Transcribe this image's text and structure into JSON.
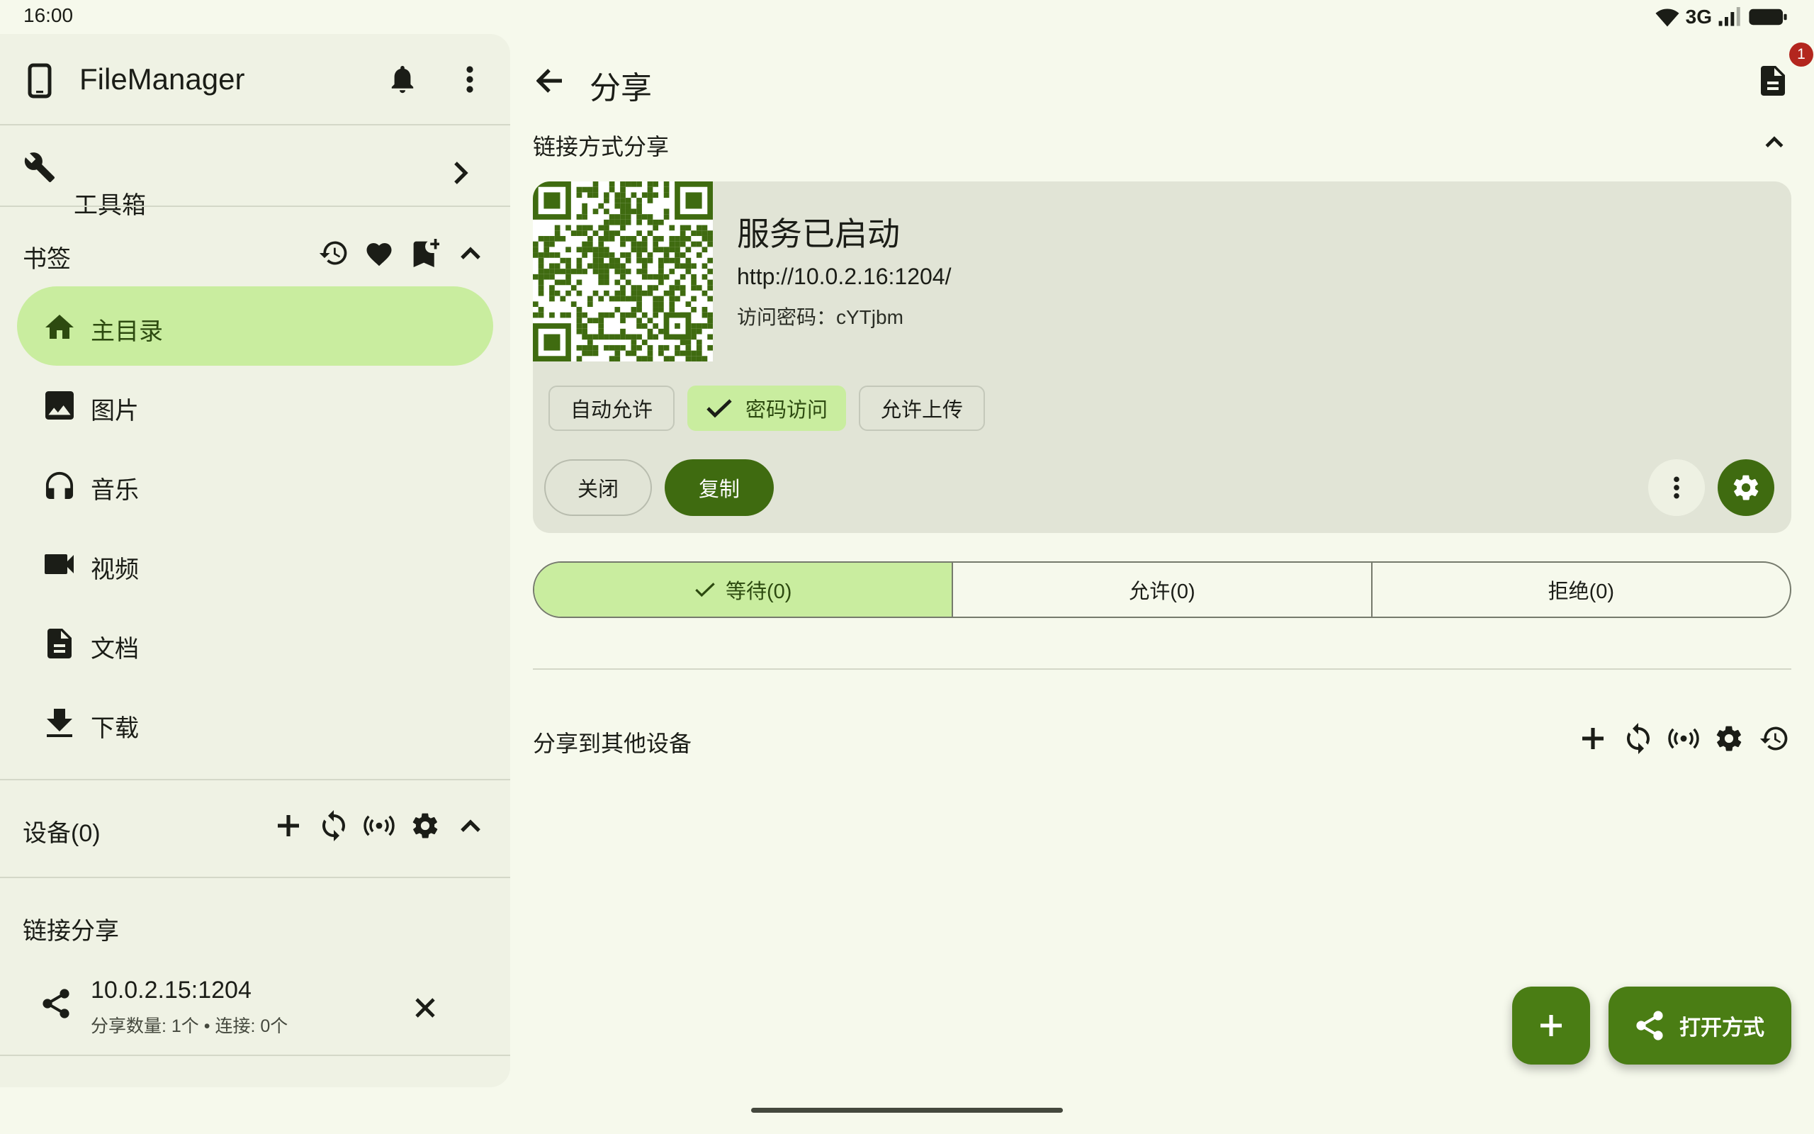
{
  "status_bar": {
    "time": "16:00",
    "network": "3G"
  },
  "drawer": {
    "app_title": "FileManager",
    "toolbox_label": "工具箱",
    "bookmarks": {
      "title": "书签",
      "items": [
        {
          "label": "主目录",
          "icon": "home-icon",
          "active": true
        },
        {
          "label": "图片",
          "icon": "image-icon",
          "active": false
        },
        {
          "label": "音乐",
          "icon": "headphones-icon",
          "active": false
        },
        {
          "label": "视频",
          "icon": "videocam-icon",
          "active": false
        },
        {
          "label": "文档",
          "icon": "document-icon",
          "active": false
        },
        {
          "label": "下载",
          "icon": "download-icon",
          "active": false
        }
      ]
    },
    "devices_title": "设备(0)",
    "link_share": {
      "title": "链接分享",
      "entry_address": "10.0.2.15:1204",
      "entry_detail": "分享数量: 1个 • 连接: 0个"
    }
  },
  "main": {
    "title": "分享",
    "notification_count": "1",
    "link_section_title": "链接方式分享",
    "card": {
      "status": "服务已启动",
      "url": "http://10.0.2.16:1204/",
      "password_line": "访问密码：cYTjbm",
      "chips": [
        {
          "label": "自动允许",
          "selected": false
        },
        {
          "label": "密码访问",
          "selected": true
        },
        {
          "label": "允许上传",
          "selected": false
        }
      ],
      "close_label": "关闭",
      "copy_label": "复制"
    },
    "segments": [
      {
        "label": "等待(0)",
        "selected": true
      },
      {
        "label": "允许(0)",
        "selected": false
      },
      {
        "label": "拒绝(0)",
        "selected": false
      }
    ],
    "other_devices_title": "分享到其他设备",
    "open_with_label": "打开方式"
  },
  "colors": {
    "accent": "#4a7d14",
    "selected_container": "#c9ed9f",
    "background": "#f6f9ec",
    "badge": "#b3261e"
  }
}
